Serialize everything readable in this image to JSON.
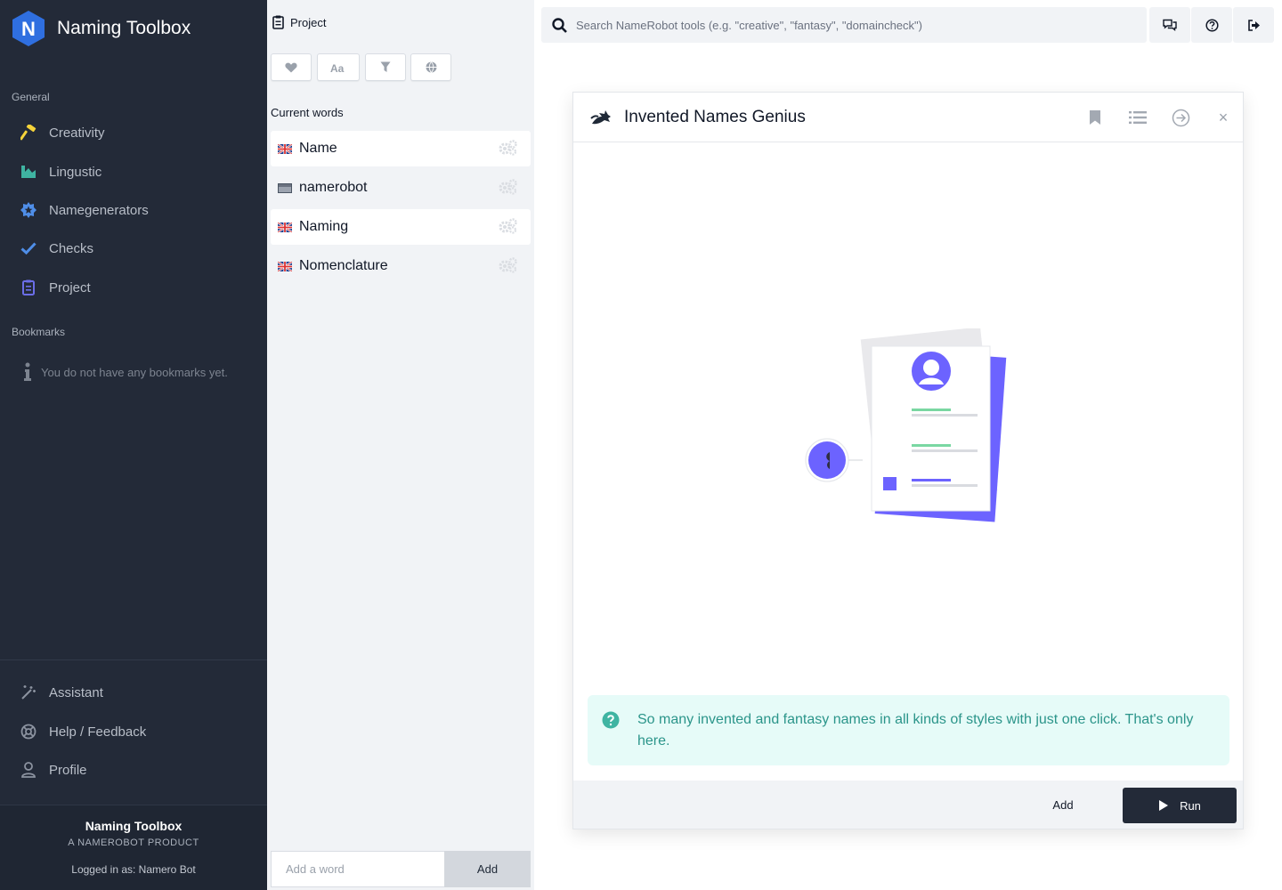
{
  "app": {
    "name": "Naming Toolbox",
    "logo_letter": "N",
    "brand_color": "#2f6fe0"
  },
  "sidebar": {
    "general_label": "General",
    "items": [
      {
        "label": "Creativity",
        "icon": "hammer-icon",
        "color": "#f5d33a"
      },
      {
        "label": "Lingustic",
        "icon": "chart-icon",
        "color": "#3fb4a2"
      },
      {
        "label": "Namegenerators",
        "icon": "star-badge-icon",
        "color": "#4f8ee8"
      },
      {
        "label": "Checks",
        "icon": "check-icon",
        "color": "#4f8ee8"
      },
      {
        "label": "Project",
        "icon": "clipboard-icon",
        "color": "#6b6ee8"
      }
    ],
    "bookmarks_label": "Bookmarks",
    "bookmarks_empty": "You do not have any bookmarks yet.",
    "bottom_items": [
      {
        "label": "Assistant",
        "icon": "magic-wand-icon"
      },
      {
        "label": "Help / Feedback",
        "icon": "lifebuoy-icon"
      },
      {
        "label": "Profile",
        "icon": "user-icon"
      }
    ],
    "footer": {
      "title": "Naming Toolbox",
      "subtitle": "A NAMEROBOT PRODUCT",
      "login": "Logged in as: Namero Bot"
    }
  },
  "project_panel": {
    "title": "Project",
    "toolbar_icons": [
      "heart-icon",
      "text-case-icon",
      "filter-icon",
      "globe-icon"
    ],
    "current_words_label": "Current words",
    "words": [
      {
        "text": "Name",
        "flag": "uk-flag"
      },
      {
        "text": "namerobot",
        "flag": "neutral-flag"
      },
      {
        "text": "Naming",
        "flag": "uk-flag"
      },
      {
        "text": "Nomenclature",
        "flag": "uk-flag"
      }
    ],
    "add_placeholder": "Add a word",
    "add_label": "Add"
  },
  "topbar": {
    "search_placeholder": "Search NameRobot tools (e.g. \"creative\", \"fantasy\", \"domaincheck\")",
    "buttons": [
      "chat-icon",
      "help-icon",
      "logout-icon"
    ]
  },
  "tool": {
    "title": "Invented Names Genius",
    "header_icons": [
      "bookmark-icon",
      "list-icon",
      "arrow-circle-icon",
      "close-icon"
    ],
    "close_glyph": "×",
    "info_text": "So many invented and fantasy names in all kinds of styles with just one click. That's only here.",
    "add_label": "Add",
    "run_label": "Run",
    "accent_color": "#6c63ff",
    "info_color": "#2b958a"
  }
}
